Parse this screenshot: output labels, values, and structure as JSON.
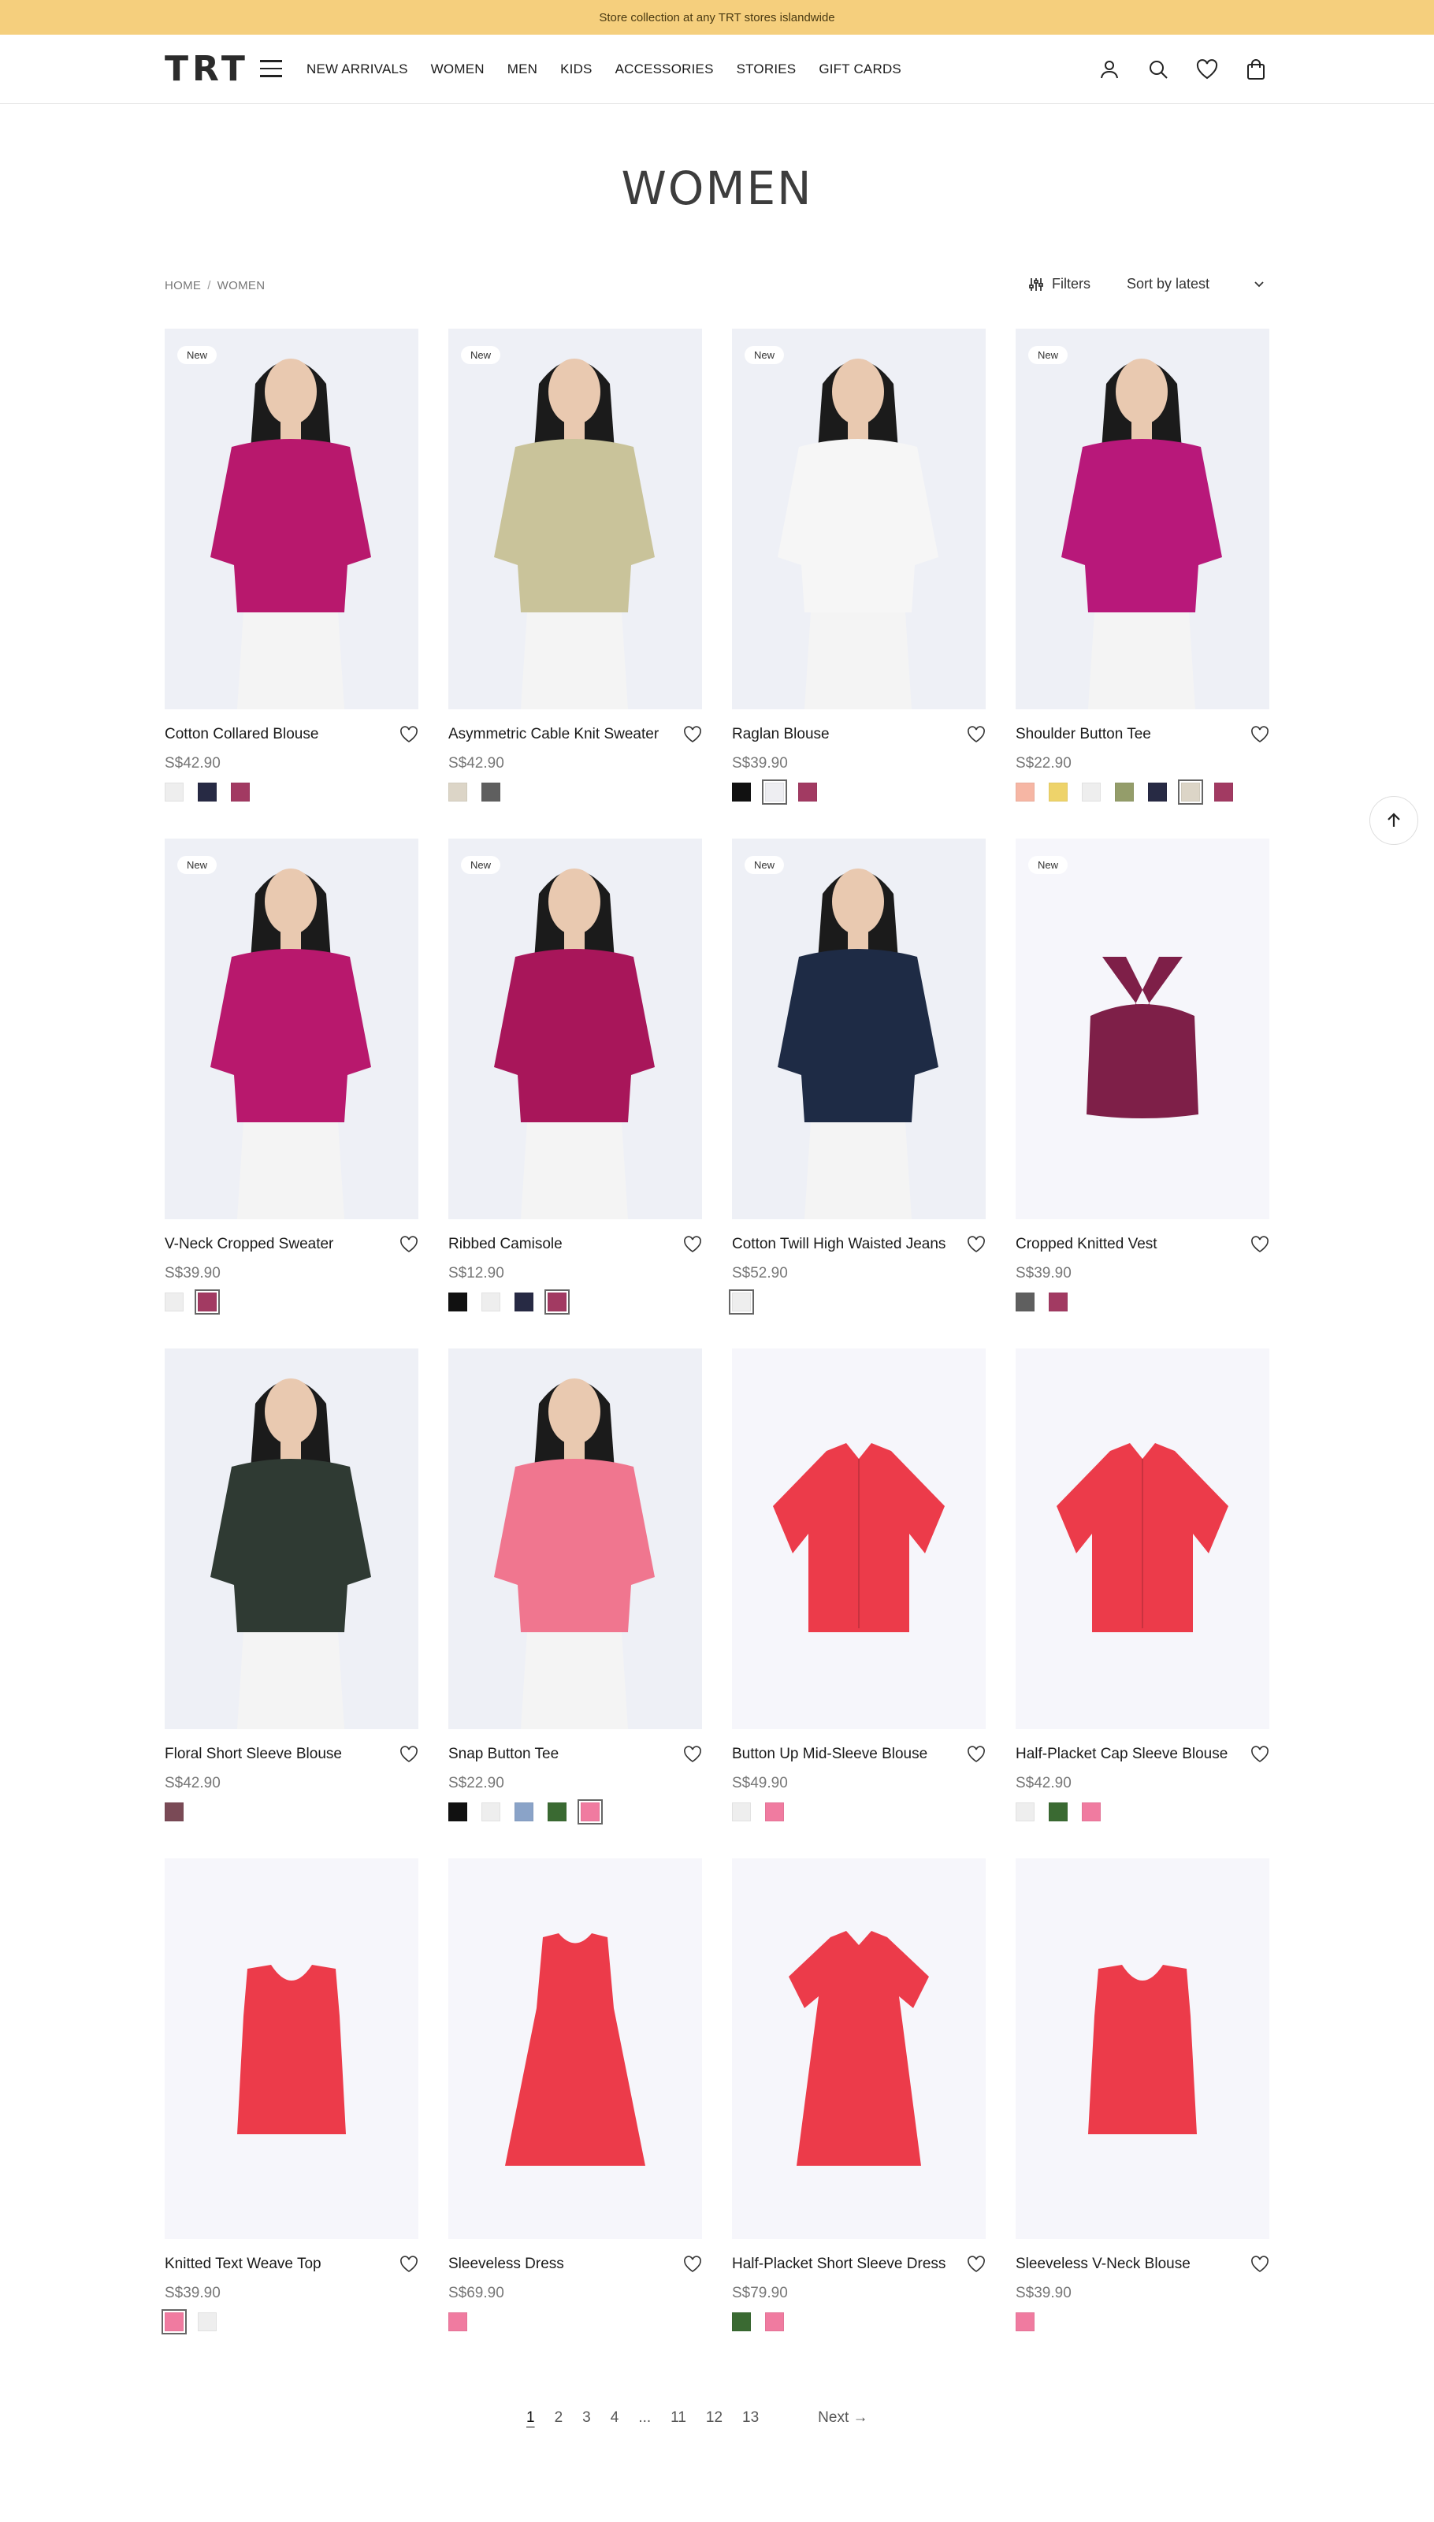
{
  "announcement": "Store collection at any TRT stores islandwide",
  "logo": "TRT",
  "nav": [
    "NEW ARRIVALS",
    "WOMEN",
    "MEN",
    "KIDS",
    "ACCESSORIES",
    "STORIES",
    "GIFT CARDS"
  ],
  "page_title": "WOMEN",
  "breadcrumb": {
    "home": "HOME",
    "sep": "/",
    "current": "WOMEN"
  },
  "filters_label": "Filters",
  "sort_label": "Sort by latest",
  "products": [
    {
      "name": "Cotton Collared Blouse",
      "price": "S$42.90",
      "badge": "New",
      "swatches": [
        "#eeeeee",
        "#272a44",
        "#a23a62"
      ],
      "sel": -1,
      "garment": "#b8186d",
      "kind": "model"
    },
    {
      "name": "Asymmetric Cable Knit Sweater",
      "price": "S$42.90",
      "badge": "New",
      "swatches": [
        "#dcd5c7",
        "#5f5f5f"
      ],
      "sel": -1,
      "garment": "#c9c39a",
      "kind": "model"
    },
    {
      "name": "Raglan Blouse",
      "price": "S$39.90",
      "badge": "New",
      "swatches": [
        "#111111",
        "#eeeef2",
        "#a23a62"
      ],
      "sel": 1,
      "garment": "#f6f6f6",
      "kind": "model"
    },
    {
      "name": "Shoulder Button Tee",
      "price": "S$22.90",
      "badge": "New",
      "swatches": [
        "#f6b6a4",
        "#eed36a",
        "#eeeeee",
        "#949d6a",
        "#272a44",
        "#dcd5c7",
        "#a23a62"
      ],
      "sel": 5,
      "garment": "#b8187a",
      "kind": "model"
    },
    {
      "name": "V-Neck Cropped Sweater",
      "price": "S$39.90",
      "badge": "New",
      "swatches": [
        "#eeeeee",
        "#a23a62"
      ],
      "sel": 1,
      "garment": "#b8186d",
      "kind": "model"
    },
    {
      "name": "Ribbed Camisole",
      "price": "S$12.90",
      "badge": "New",
      "swatches": [
        "#111111",
        "#eeeeee",
        "#272a44",
        "#a23a62"
      ],
      "sel": 3,
      "garment": "#a8165a",
      "kind": "model"
    },
    {
      "name": "Cotton Twill High Waisted Jeans",
      "price": "S$52.90",
      "badge": "New",
      "swatches": [
        "#eeeeee"
      ],
      "sel": 0,
      "garment": "#1e2b45",
      "kind": "model"
    },
    {
      "name": "Cropped Knitted Vest",
      "price": "S$39.90",
      "badge": "New",
      "swatches": [
        "#5f5f5f",
        "#a23a62"
      ],
      "sel": -1,
      "garment": "#7e1f48",
      "kind": "flat-bra"
    },
    {
      "name": "Floral Short Sleeve Blouse",
      "price": "S$42.90",
      "badge": "",
      "swatches": [
        "#7a4a56"
      ],
      "sel": -1,
      "garment": "#2f3a33",
      "kind": "model"
    },
    {
      "name": "Snap Button Tee",
      "price": "S$22.90",
      "badge": "",
      "swatches": [
        "#111111",
        "#eeeeee",
        "#8aa3c8",
        "#3a6a32",
        "#f07ba0"
      ],
      "sel": 4,
      "garment": "#f0768f",
      "kind": "model"
    },
    {
      "name": "Button Up Mid-Sleeve Blouse",
      "price": "S$49.90",
      "badge": "",
      "swatches": [
        "#eeeeee",
        "#f07ba0"
      ],
      "sel": -1,
      "garment": "#ec3b4a",
      "kind": "flat-shirt"
    },
    {
      "name": "Half-Placket Cap Sleeve Blouse",
      "price": "S$42.90",
      "badge": "",
      "swatches": [
        "#eeeeee",
        "#3a6a32",
        "#f07ba0"
      ],
      "sel": -1,
      "garment": "#ec3b4a",
      "kind": "flat-shirt"
    },
    {
      "name": "Knitted Text Weave Top",
      "price": "S$39.90",
      "badge": "",
      "swatches": [
        "#f07ba0",
        "#eeeeee"
      ],
      "sel": 0,
      "garment": "#ec3b4a",
      "kind": "flat-vest"
    },
    {
      "name": "Sleeveless Dress",
      "price": "S$69.90",
      "badge": "",
      "swatches": [
        "#f07ba0"
      ],
      "sel": -1,
      "garment": "#ec3b4a",
      "kind": "flat-dress"
    },
    {
      "name": "Half-Placket Short Sleeve Dress",
      "price": "S$79.90",
      "badge": "",
      "swatches": [
        "#3a6a32",
        "#f07ba0"
      ],
      "sel": -1,
      "garment": "#ec3b4a",
      "kind": "flat-shirtdress"
    },
    {
      "name": "Sleeveless V-Neck Blouse",
      "price": "S$39.90",
      "badge": "",
      "swatches": [
        "#f07ba0"
      ],
      "sel": -1,
      "garment": "#ec3b4a",
      "kind": "flat-vest"
    }
  ],
  "pagination": {
    "pages": [
      "1",
      "2",
      "3",
      "4",
      "...",
      "11",
      "12",
      "13"
    ],
    "current": "1",
    "next": "Next →"
  }
}
